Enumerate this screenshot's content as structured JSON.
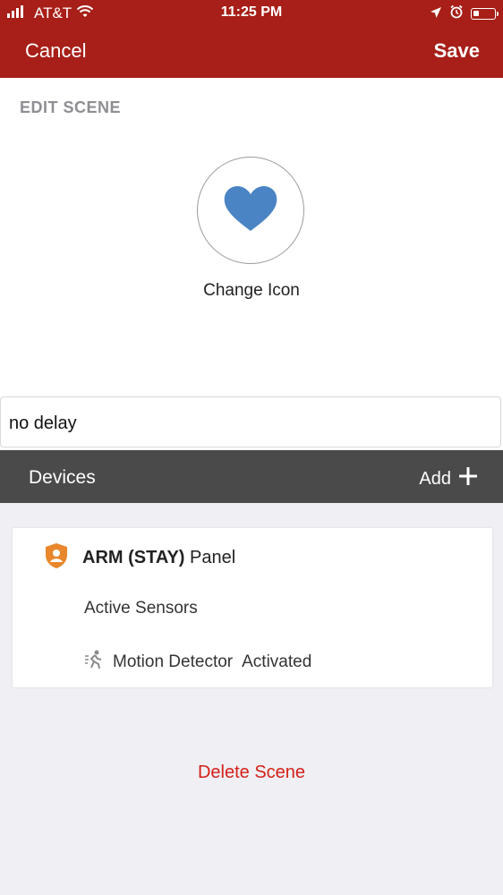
{
  "status_bar": {
    "carrier": "AT&T",
    "time": "11:25 PM",
    "icons": [
      "signal-icon",
      "wifi-icon",
      "location-icon",
      "alarm-icon",
      "battery-icon"
    ]
  },
  "nav": {
    "cancel_label": "Cancel",
    "save_label": "Save",
    "colors": {
      "header_bg": "#a71f18",
      "text": "#ffffff"
    }
  },
  "edit_scene": {
    "title": "EDIT SCENE",
    "icon_name": "heart-icon",
    "icon_color": "#4a84c4",
    "change_icon_label": "Change Icon"
  },
  "scene_name": {
    "value": "no delay"
  },
  "devices": {
    "title": "Devices",
    "add_label": "Add",
    "bar_color": "#4a4a4a"
  },
  "card": {
    "panel_bold": "ARM (STAY)",
    "panel_label": "Panel",
    "active_sensors_label": "Active Sensors",
    "motion_detector_label": "Motion Detector",
    "motion_state": "Activated",
    "panel_icon_color": "#e8872b"
  },
  "footer": {
    "delete_label": "Delete Scene",
    "delete_color": "#d32018"
  }
}
